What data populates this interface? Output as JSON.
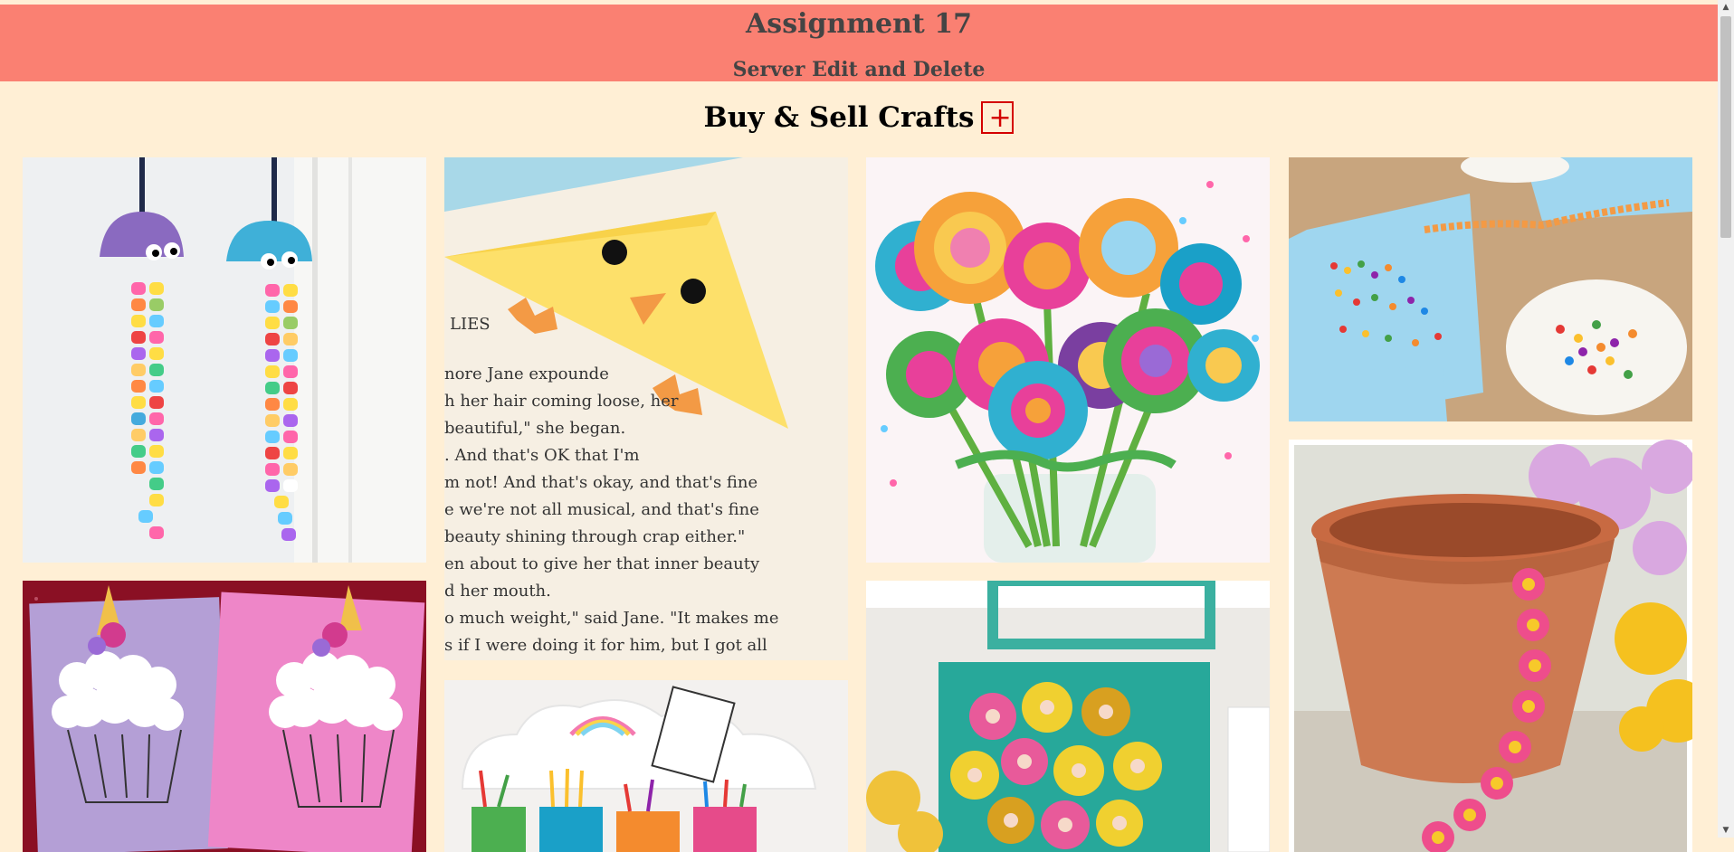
{
  "header": {
    "title": "Assignment 17",
    "subtitle": "Server Edit and Delete"
  },
  "section": {
    "title": "Buy & Sell Crafts",
    "add_label": "+"
  },
  "crafts": [
    {
      "name": "egg-carton-jellyfish-craft"
    },
    {
      "name": "chick-corner-bookmark-craft"
    },
    {
      "name": "felt-button-flowers-craft"
    },
    {
      "name": "cereal-counting-craft"
    },
    {
      "name": "cupcake-unicorn-craft"
    },
    {
      "name": "rainbow-cloud-desk-organizer-craft"
    },
    {
      "name": "egg-carton-flower-canvas-craft"
    },
    {
      "name": "flower-pot-ribbon-craft"
    }
  ],
  "colors": {
    "background": "#ffefd5",
    "header": "#fa8072",
    "header_text": "#444444",
    "add_button": "#d40000"
  },
  "scrollbar": {
    "up_icon": "▲",
    "down_icon": "▼"
  }
}
